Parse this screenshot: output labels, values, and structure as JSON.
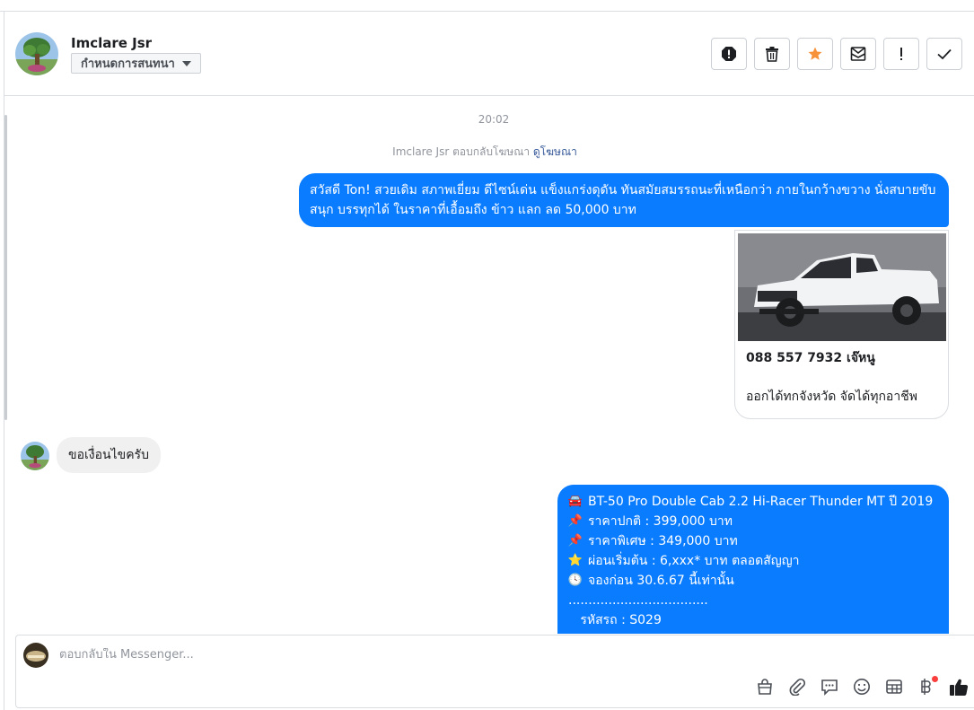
{
  "header": {
    "contact_name": "Imclare Jsr",
    "assign_label": "กำหนดการสนทนา",
    "actions": [
      {
        "icon": "spam-icon"
      },
      {
        "icon": "trash-icon"
      },
      {
        "icon": "star-icon"
      },
      {
        "icon": "unread-icon"
      },
      {
        "icon": "follow-up-icon"
      },
      {
        "icon": "done-icon"
      }
    ],
    "star_color": "#f7923a"
  },
  "thread": {
    "time": "20:02",
    "notice": {
      "text": "Imclare Jsr ตอบกลับโฆษณา",
      "link": "ดูโฆษณา"
    },
    "message_out_1": "สวัสดี Ton! สวยเดิม สภาพเยี่ยม ดีไซน์เด่น แข็งแกร่งดุดัน ทันสมัยสมรรถนะที่เหนือกว่า ภายในกว้างขวาง นั่งสบายขับสนุก บรรทุกได้ ในราคาที่เอื้อมถึง  ข้าว แลก ลด 50,000 บาท",
    "card": {
      "title": "088 557 7932 เจ๊หนู",
      "subtitle": "ออกได้ทกจังหวัด จัดได้ทุกอาชีพ"
    },
    "message_in_1": "ขอเงื่อนไขครับ",
    "message_out_2": {
      "lines": [
        {
          "icon": "🚘",
          "text": "BT-50 Pro Double Cab 2.2 Hi-Racer Thunder MT ปี 2019"
        },
        {
          "icon": "📌",
          "text": "ราคาปกติ : 399,000 บาท"
        },
        {
          "icon": "📌",
          "text": "ราคาพิเศษ : 349,000 บาท"
        },
        {
          "icon": "⭐",
          "text": "ผ่อนเริ่มต้น : 6,xxx* บาท  ตลอดสัญญา"
        },
        {
          "icon": "🕓",
          "text": "จองก่อน 30.6.67 นี้เท่านั้น"
        },
        {
          "icon": "",
          "text": "..................................."
        },
        {
          "icon": "",
          "text": "   รหัสรถ : S029"
        }
      ]
    },
    "accent_color": "#0a7cff"
  },
  "composer": {
    "placeholder": "ตอบกลับใน Messenger...",
    "tools": [
      "shop-icon",
      "attachment-icon",
      "saved-reply-icon",
      "emoji-icon",
      "template-icon",
      "baht-payment-icon",
      "like-icon"
    ]
  }
}
